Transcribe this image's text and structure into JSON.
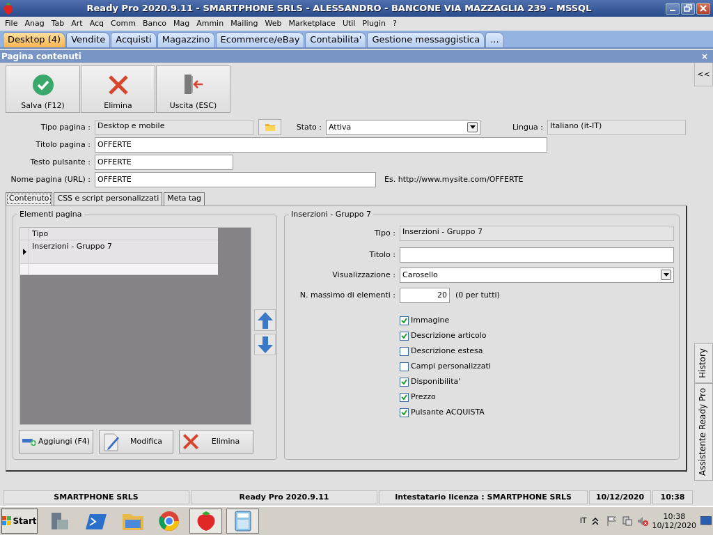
{
  "window": {
    "title": "Ready Pro 2020.9.11 - SMARTPHONE SRLS - ALESSANDRO - BANCONE VIA MAZZAGLIA 239 - MSSQL"
  },
  "menu": [
    "File",
    "Anag",
    "Tab",
    "Art",
    "Acq",
    "Comm",
    "Banco",
    "Mag",
    "Ammin",
    "Mailing",
    "Web",
    "Marketplace",
    "Util",
    "Plugin",
    "?"
  ],
  "tabs": [
    {
      "label": "Desktop (4)",
      "selected": true
    },
    {
      "label": "Vendite",
      "selected": false
    },
    {
      "label": "Acquisti",
      "selected": false
    },
    {
      "label": "Magazzino",
      "selected": false
    },
    {
      "label": "Ecommerce/eBay",
      "selected": false
    },
    {
      "label": "Contabilita'",
      "selected": false
    },
    {
      "label": "Gestione messaggistica",
      "selected": false
    },
    {
      "label": "...",
      "selected": false
    }
  ],
  "panel": {
    "title": "Pagina contenuti",
    "close": "×"
  },
  "side_toggle": "<<",
  "toolbar": [
    {
      "label": "Salva (F12)",
      "kind": "save"
    },
    {
      "label": "Elimina",
      "kind": "delete"
    },
    {
      "label": "Uscita (ESC)",
      "kind": "exit"
    }
  ],
  "form": {
    "tipo_pagina": {
      "label": "Tipo pagina :",
      "value": "Desktop e mobile"
    },
    "stato": {
      "label": "Stato :",
      "value": "Attiva"
    },
    "lingua": {
      "label": "Lingua :",
      "value": "Italiano (it-IT)"
    },
    "titolo_pagina": {
      "label": "Titolo pagina :",
      "value": "OFFERTE"
    },
    "testo_pulsante": {
      "label": "Testo pulsante :",
      "value": "OFFERTE"
    },
    "nome_pagina": {
      "label": "Nome pagina (URL) :",
      "value": "OFFERTE",
      "example": "Es. http://www.mysite.com/OFFERTE"
    }
  },
  "subtabs": [
    {
      "label": "Contenuto",
      "selected": true
    },
    {
      "label": "CSS e script personalizzati",
      "selected": false
    },
    {
      "label": "Meta tag",
      "selected": false
    }
  ],
  "elements_group": {
    "title": "Elementi pagina",
    "grid": {
      "columns": [
        "Tipo"
      ],
      "rows": [
        {
          "cells": [
            "Inserzioni - Gruppo 7"
          ],
          "selected": true
        }
      ]
    },
    "buttons": [
      {
        "label": "Aggiungi (F4)",
        "kind": "add"
      },
      {
        "label": "Modifica",
        "kind": "edit"
      },
      {
        "label": "Elimina",
        "kind": "delete"
      }
    ]
  },
  "details_group": {
    "title": "Inserzioni - Gruppo 7",
    "tipo": {
      "label": "Tipo :",
      "value": "Inserzioni - Gruppo 7"
    },
    "titolo": {
      "label": "Titolo :"
    },
    "visualizzazione": {
      "label": "Visualizzazione :",
      "value": "Carosello"
    },
    "massimo": {
      "label": "N. massimo di elementi :",
      "value": "20",
      "note": "(0 per tutti)"
    },
    "options": [
      {
        "label": "Immagine",
        "checked": true
      },
      {
        "label": "Descrizione articolo",
        "checked": true
      },
      {
        "label": "Descrizione estesa",
        "checked": false
      },
      {
        "label": "Campi personalizzati",
        "checked": false
      },
      {
        "label": "Disponibilita'",
        "checked": true
      },
      {
        "label": "Prezzo",
        "checked": true
      },
      {
        "label": "Pulsante ACQUISTA",
        "checked": true
      }
    ]
  },
  "side_tabs": [
    "History",
    "Assistente Ready Pro"
  ],
  "status_bar": [
    "SMARTPHONE SRLS",
    "Ready Pro 2020.9.11",
    "Intestatario licenza : SMARTPHONE SRLS",
    "10/12/2020",
    "10:38"
  ],
  "taskbar": {
    "start": "Start",
    "language": "IT",
    "time": "10:38",
    "date": "10/12/2020"
  }
}
